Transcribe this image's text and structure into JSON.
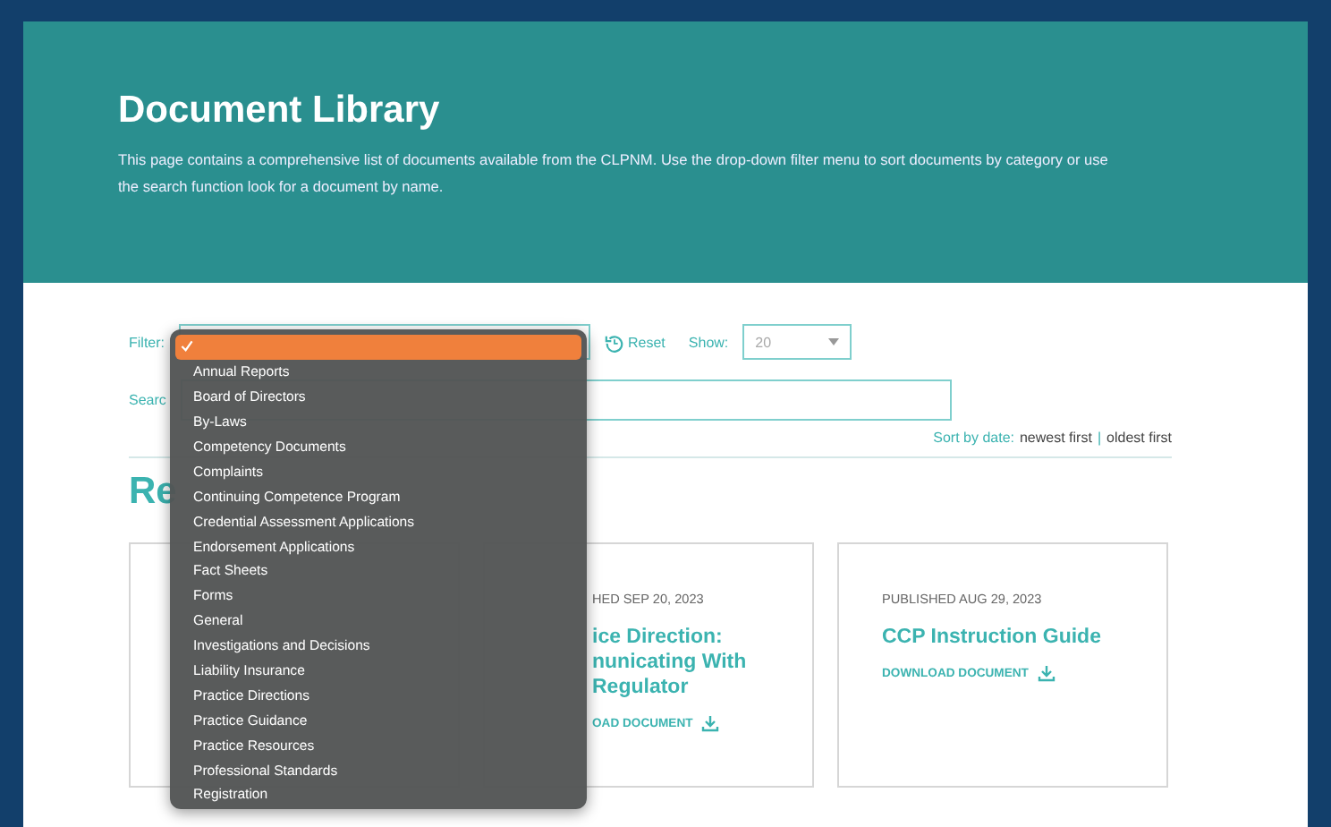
{
  "header": {
    "title": "Document Library",
    "description": "This page contains a comprehensive list of documents available from the CLPNM. Use the drop-down filter menu to sort documents by category or use the search function look for a document by name."
  },
  "filter": {
    "label": "Filter:",
    "reset": "Reset",
    "show_label": "Show:",
    "show_value": "20"
  },
  "search": {
    "label": "Searc"
  },
  "sort": {
    "label": "Sort by date:",
    "newest": "newest first",
    "separator": "|",
    "oldest": "oldest first"
  },
  "section_title": "Re",
  "cards": [
    {
      "published": "HED SEP 20, 2023",
      "title": "ice Direction: nunicating With Regulator",
      "download": "OAD DOCUMENT",
      "clipped": true
    },
    {
      "published": "PUBLISHED AUG 29, 2023",
      "title": "CCP Instruction Guide",
      "download": "DOWNLOAD DOCUMENT",
      "clipped": false
    }
  ],
  "dropdown": {
    "options": [
      {
        "selected": true
      },
      {
        "label": "Annual Reports",
        "selected": false
      },
      {
        "label": "Board of Directors",
        "selected": false
      },
      {
        "label": "By-Laws",
        "selected": false
      },
      {
        "label": "Competency Documents",
        "selected": false
      },
      {
        "label": "Complaints",
        "selected": false
      },
      {
        "label": "Continuing Competence Program",
        "selected": false
      },
      {
        "label": "Credential Assessment Applications",
        "selected": false
      },
      {
        "label": "Endorsement Applications",
        "selected": false
      },
      {
        "label": "Fact Sheets",
        "selected": false
      },
      {
        "label": "Forms",
        "selected": false
      },
      {
        "label": "General",
        "selected": false
      },
      {
        "label": "Investigations and Decisions",
        "selected": false
      },
      {
        "label": "Liability Insurance",
        "selected": false
      },
      {
        "label": "Practice Directions",
        "selected": false
      },
      {
        "label": "Practice Guidance",
        "selected": false
      },
      {
        "label": "Practice Resources",
        "selected": false
      },
      {
        "label": "Professional Standards",
        "selected": false
      },
      {
        "label": "Registration",
        "selected": false
      }
    ]
  }
}
